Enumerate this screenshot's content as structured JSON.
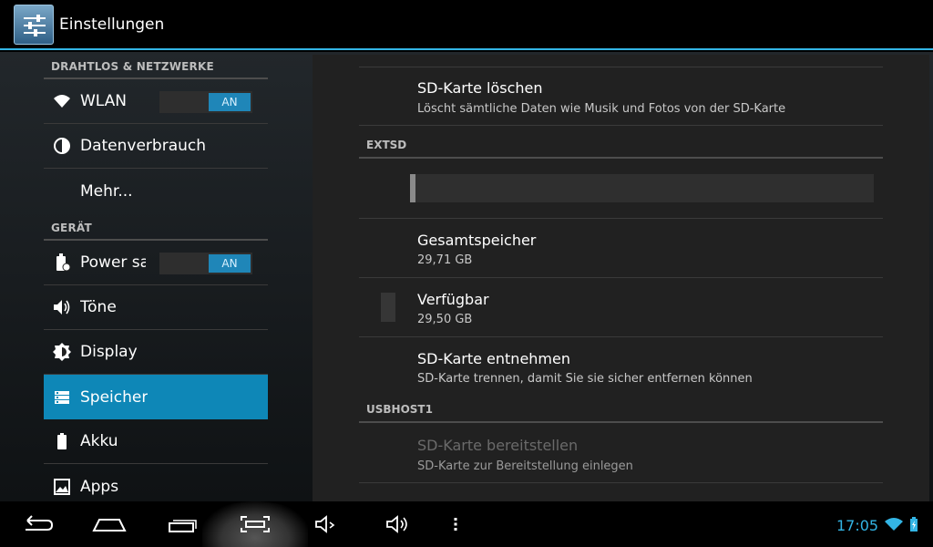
{
  "app": {
    "title": "Einstellungen",
    "icon": "settings-sliders-icon"
  },
  "sidebar": {
    "sections": [
      {
        "header": "DRAHTLOS & NETZWERKE",
        "items": [
          {
            "label": "WLAN",
            "icon": "wifi-icon",
            "toggle": "AN"
          },
          {
            "label": "Datenverbrauch",
            "icon": "data-usage-icon"
          },
          {
            "label": "Mehr...",
            "icon": ""
          }
        ]
      },
      {
        "header": "GERÄT",
        "items": [
          {
            "label": "Power saving",
            "icon": "battery-saver-icon",
            "toggle": "AN"
          },
          {
            "label": "Töne",
            "icon": "speaker-icon"
          },
          {
            "label": "Display",
            "icon": "brightness-icon"
          },
          {
            "label": "Speicher",
            "icon": "storage-icon",
            "selected": true
          },
          {
            "label": "Akku",
            "icon": "battery-icon"
          },
          {
            "label": "Apps",
            "icon": "apps-icon"
          }
        ]
      }
    ]
  },
  "main": {
    "sd_clear": {
      "title": "SD-Karte löschen",
      "summary": "Löscht sämtliche Daten wie Musik und Fotos von der SD-Karte"
    },
    "extsd_header": "EXTSD",
    "usage_bar_fraction": 0.01,
    "total": {
      "title": "Gesamtspeicher",
      "value": "29,71 GB"
    },
    "available": {
      "title": "Verfügbar",
      "value": "29,50 GB"
    },
    "sd_eject": {
      "title": "SD-Karte entnehmen",
      "summary": "SD-Karte trennen, damit Sie sie sicher entfernen können"
    },
    "usbhost_header": "USBHOST1",
    "sd_mount": {
      "title": "SD-Karte bereitstellen",
      "summary": "SD-Karte zur Bereitstellung einlegen"
    }
  },
  "navbar": {
    "buttons": [
      "back-icon",
      "home-icon",
      "recent-apps-icon",
      "screenshot-icon",
      "volume-down-icon",
      "volume-up-icon",
      "menu-icon"
    ],
    "time": "17:05"
  },
  "colors": {
    "accent": "#33b5e5",
    "selected": "#0e87b7",
    "toggle_on": "#1f86b8"
  }
}
